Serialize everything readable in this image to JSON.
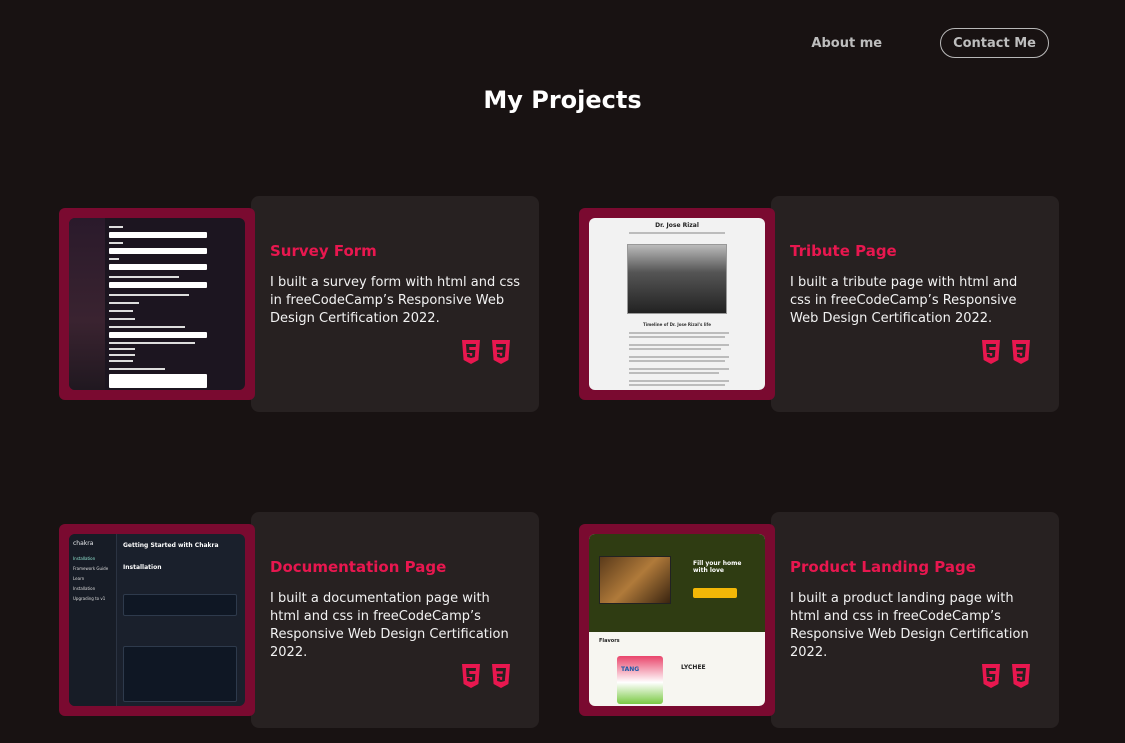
{
  "nav": {
    "about_label": "About me",
    "contact_label": "Contact Me"
  },
  "page_title": "My Projects",
  "projects": [
    {
      "title": "Survey Form",
      "description": "I built a survey form with html and css in freeCodeCamp’s Responsive Web Design Certification 2022.",
      "thumb": "survey-form-screenshot"
    },
    {
      "title": "Tribute Page",
      "description": "I built a tribute page with html and css in freeCodeCamp’s Responsive Web Design Certification 2022.",
      "thumb": "tribute-page-screenshot",
      "thumb_text": {
        "heading": "Dr. Jose Rizal",
        "subheading": "Timeline of Dr. Jose Rizal's life"
      }
    },
    {
      "title": "Documentation Page",
      "description": "I built a documentation page with html and css in freeCodeCamp’s Responsive Web Design Certification 2022.",
      "thumb": "documentation-page-screenshot",
      "thumb_text": {
        "logo": "chakra",
        "heading": "Getting Started with Chakra",
        "section": "Installation",
        "nav": [
          "Installation",
          "Framework Guide",
          "Learn",
          "Installation",
          "Upgrading to v1"
        ]
      }
    },
    {
      "title": "Product Landing Page",
      "description": "I built a product landing page with html and css in freeCodeCamp’s Responsive Web Design Certification 2022.",
      "thumb": "product-landing-page-screenshot",
      "thumb_text": {
        "hero": "Fill your home with love",
        "flavors": "Flavors",
        "product": "LYCHEE",
        "brand": "TANG"
      }
    }
  ],
  "icons": {
    "html5": "html5-icon",
    "css3": "css3-icon"
  },
  "colors": {
    "background": "#181212",
    "card": "#272121",
    "accent": "#e8174f",
    "frame": "#7a0a30"
  }
}
